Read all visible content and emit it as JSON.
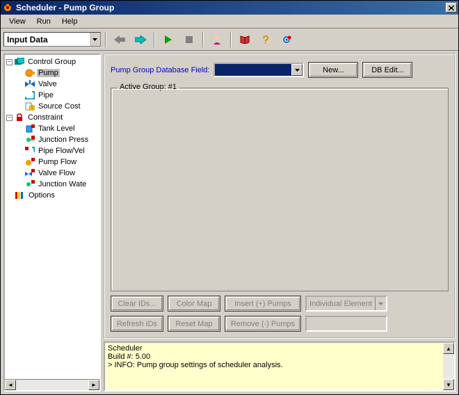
{
  "window": {
    "title": "Scheduler - Pump Group"
  },
  "menu": {
    "view": "View",
    "run": "Run",
    "help": "Help"
  },
  "toolbar": {
    "mode": "Input Data"
  },
  "tree": {
    "root": "Control Group",
    "items": [
      "Pump",
      "Valve",
      "Pipe",
      "Source Cost"
    ],
    "constraint": "Constraint",
    "citems": [
      "Tank Level",
      "Junction Press",
      "Pipe Flow/Vel",
      "Pump Flow",
      "Valve Flow",
      "Junction Wate"
    ],
    "options": "Options"
  },
  "form": {
    "dblabel": "Pump Group Database Field:",
    "new": "New...",
    "dbedit": "DB Edit...",
    "grouplabel": "Active Group: #1",
    "clearids": "Clear IDs...",
    "colormap": "Color Map",
    "insert": "Insert (+) Pumps",
    "element": "Individual Element",
    "refreshids": "Refresh IDs",
    "resetmap": "Reset Map",
    "remove": "Remove (-) Pumps"
  },
  "log": {
    "line1": "Scheduler",
    "line2": "Build #: 5.00",
    "line3": "> INFO: Pump group settings of scheduler analysis."
  }
}
